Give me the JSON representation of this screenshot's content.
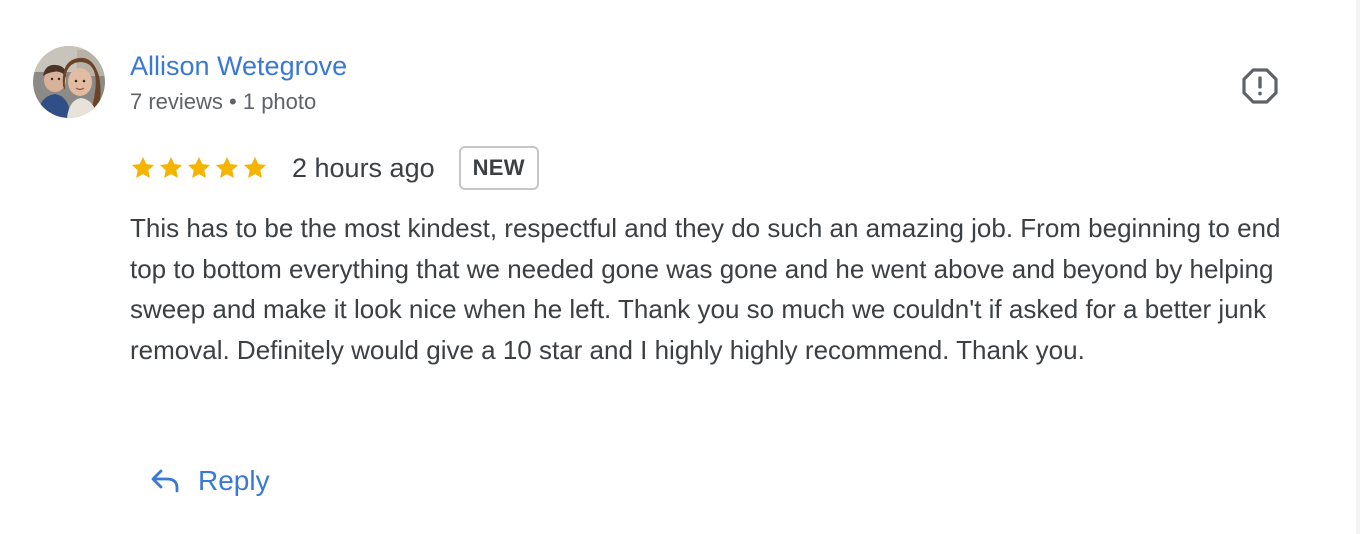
{
  "reviewer": {
    "name": "Allison Wetegrove",
    "meta": "7 reviews • 1 photo",
    "avatar_icon": "profile-photo"
  },
  "review": {
    "rating": 5,
    "rating_max": 5,
    "timestamp": "2 hours ago",
    "badge": "NEW",
    "text": "This has to be the most kindest, respectful and they do such an amazing job. From beginning to end top to bottom everything that we needed gone was gone and he went above and beyond by helping sweep and make it look nice when he left. Thank you so much we couldn't if asked for a better junk removal. Definitely would give a 10 star and I highly highly recommend. Thank you."
  },
  "actions": {
    "flag_icon": "report-flag-icon",
    "reply_icon": "reply-arrow-icon",
    "reply_label": "Reply"
  },
  "colors": {
    "name_link": "#3a78d6",
    "star": "#f4b400",
    "text": "#3c4043",
    "secondary_text": "#5f6368",
    "badge_border": "#c4c7c5",
    "icon": "#5f6368"
  }
}
